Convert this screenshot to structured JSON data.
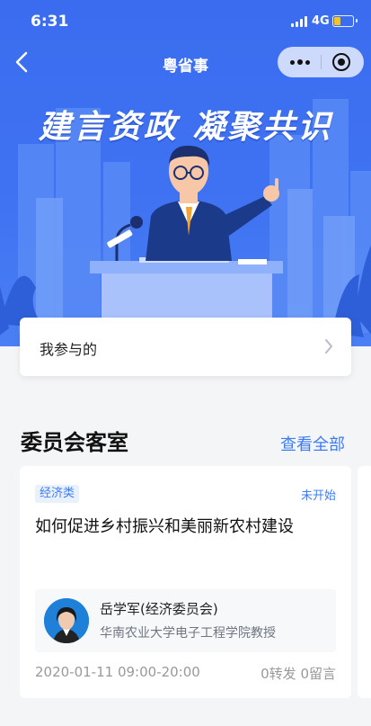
{
  "status_bar": {
    "time": "6:31",
    "network": "4G"
  },
  "nav": {
    "title": "粤省事"
  },
  "banner": {
    "slogan": "建言资政  凝聚共识"
  },
  "my_participation": {
    "label": "我参与的"
  },
  "section": {
    "title": "委员会客室",
    "view_all": "查看全部"
  },
  "room": {
    "tag": "经济类",
    "status": "未开始",
    "title": "如何促进乡村振兴和美丽新农村建设",
    "person_name": "岳学军(经济委员会)",
    "person_title": "华南农业大学电子工程学院教授",
    "time": "2020-01-11 09:00-20:00",
    "stats": "0转发 0留言"
  },
  "colors": {
    "brand_blue": "#3f73f2",
    "link_blue": "#3d7cf0",
    "battery": "#f5c518"
  }
}
